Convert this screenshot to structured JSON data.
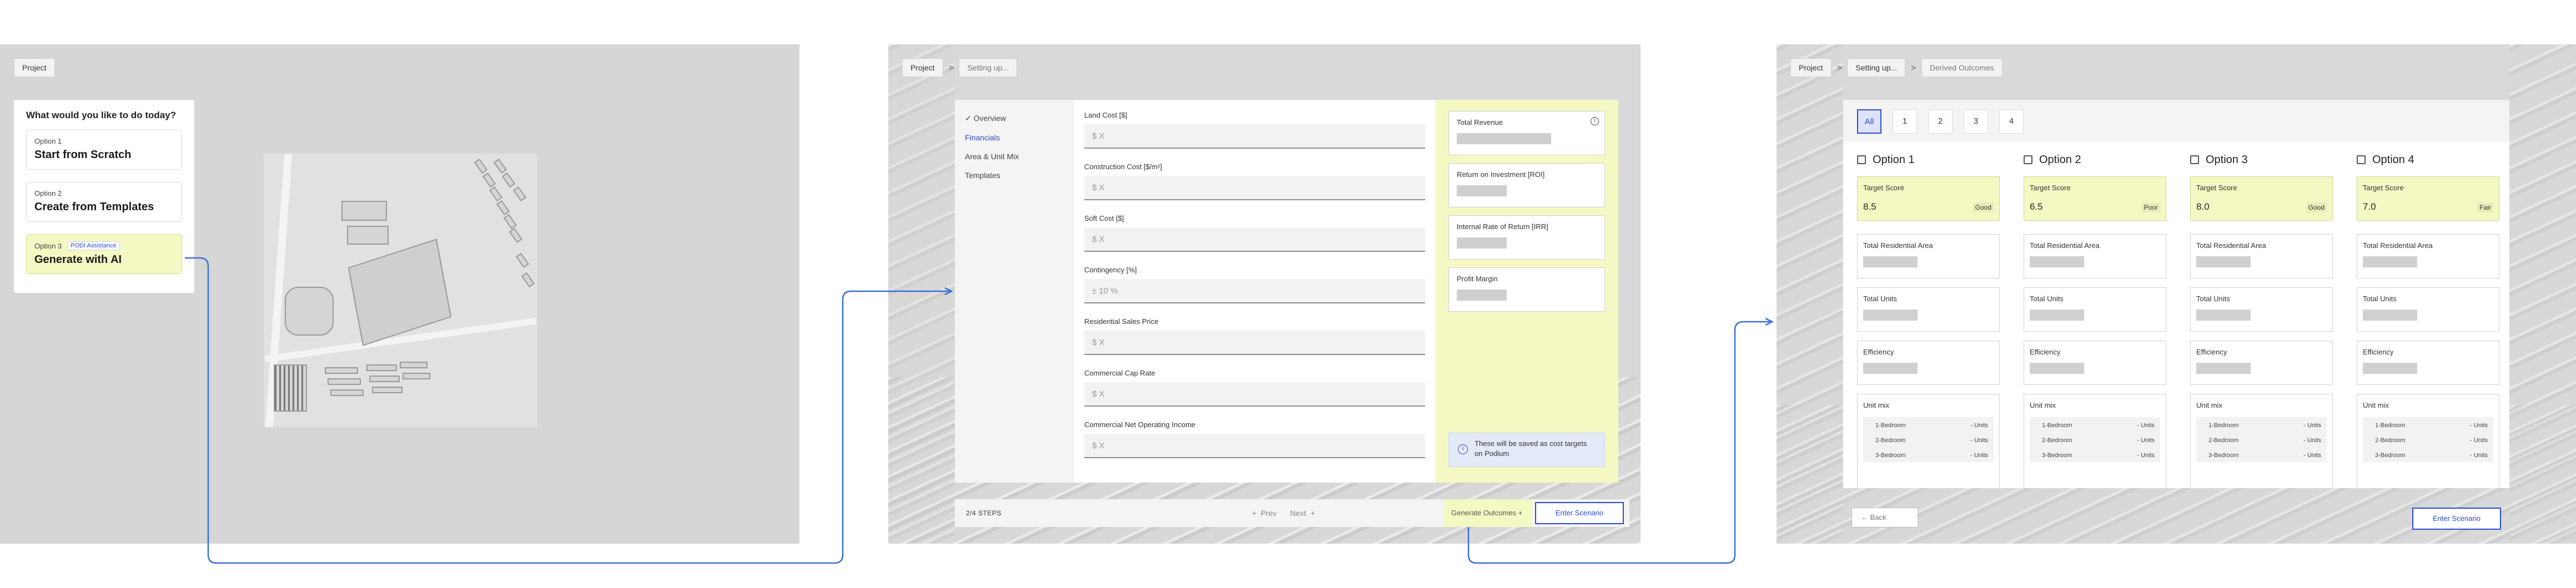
{
  "colors": {
    "accent": "#2a4bd1",
    "highlight": "#f4f9c3",
    "connector": "#3a6fd8"
  },
  "panel1": {
    "breadcrumb": [
      "Project"
    ],
    "card_title": "What would you like to do today?",
    "options": [
      {
        "small": "Option 1",
        "big": "Start from Scratch"
      },
      {
        "small": "Option 2",
        "big": "Create from Templates"
      },
      {
        "small": "Option 3",
        "badge": "PODI Assistance",
        "big": "Generate with AI"
      }
    ]
  },
  "panel2": {
    "breadcrumb": [
      "Project",
      "Setting up..."
    ],
    "nav": [
      {
        "label": "Overview",
        "icon": "checkmark-icon"
      },
      {
        "label": "Financials"
      },
      {
        "label": "Area & Unit Mix"
      },
      {
        "label": "Templates"
      }
    ],
    "fields": [
      {
        "label": "Land Cost [$]",
        "placeholder": "$ X"
      },
      {
        "label": "Construction Cost [$/m²]",
        "placeholder": "$ X"
      },
      {
        "label": "Soft Cost [$]",
        "placeholder": "$ X"
      },
      {
        "label": "Contingency [%]",
        "placeholder": "± 10 %"
      },
      {
        "label": "Residential Sales Price",
        "placeholder": "$ X"
      },
      {
        "label": "Commercial Cap Rate",
        "placeholder": "$ X"
      },
      {
        "label": "Commercial Net Operating Income",
        "placeholder": "$ X"
      }
    ],
    "targets": [
      {
        "label": "Total Revenue"
      },
      {
        "label": "Return on Investment [ROI]"
      },
      {
        "label": "Internal Rate of Return [IRR]"
      },
      {
        "label": "Profit Margin"
      }
    ],
    "note": "These will be saved as cost targets on Podium",
    "stepper": {
      "steps": "2/4  STEPS",
      "prev": "Prev",
      "next": "Next"
    },
    "generate_label": "Generate Outcomes",
    "enter_label": "Enter Scenario"
  },
  "panel3": {
    "breadcrumb": [
      "Project",
      "Setting up...",
      "Derived Outcomes"
    ],
    "chips": [
      "All",
      "1",
      "2",
      "3",
      "4"
    ],
    "metric_labels": {
      "score": "Target Score",
      "area": "Total Residential Area",
      "units": "Total Units",
      "efficiency": "Efficiency",
      "unitmix": "Unit mix"
    },
    "unit_mix_rows": [
      {
        "type": "1-Bedroom",
        "value": "- Units"
      },
      {
        "type": "2-Bedroom",
        "value": "- Units"
      },
      {
        "type": "3-Bedroom",
        "value": "- Units"
      }
    ],
    "options": [
      {
        "name": "Option 1",
        "score": "8.5",
        "rating": "Good"
      },
      {
        "name": "Option 2",
        "score": "6.5",
        "rating": "Poor"
      },
      {
        "name": "Option 3",
        "score": "8.0",
        "rating": "Good"
      },
      {
        "name": "Option 4",
        "score": "7.0",
        "rating": "Fair"
      }
    ],
    "back_label": "← Back",
    "enter_label": "Enter Scenario"
  }
}
